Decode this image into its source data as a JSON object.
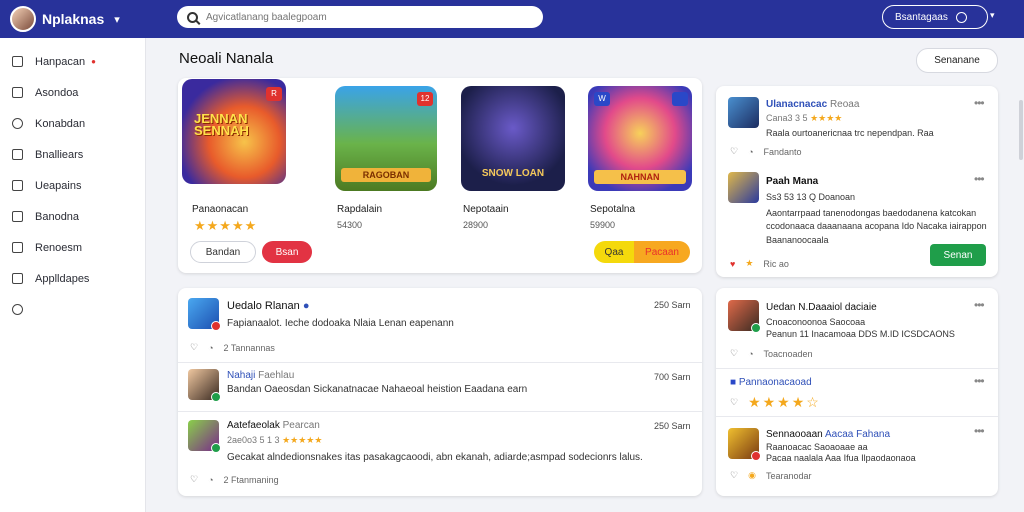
{
  "header": {
    "brand_name": "Nplaknas",
    "search_placeholder": "Agvicatlanang baalegpoam",
    "account_label": "Bsantagaas"
  },
  "sidebar": {
    "items": [
      {
        "label": "Hanpacan",
        "badge": "●"
      },
      {
        "label": "Asondoa"
      },
      {
        "label": "Konabdan"
      },
      {
        "label": "Bnalliears"
      },
      {
        "label": "Ueapains"
      },
      {
        "label": "Banodna"
      },
      {
        "label": "Renoesm"
      },
      {
        "label": "Applldapes"
      },
      {
        "label": ""
      }
    ]
  },
  "main": {
    "title": "Neoali Nanala",
    "action_label": "Senanane",
    "games": [
      {
        "name": "Panaonacan",
        "sub": "",
        "rating": "★★★★★",
        "thumb_text": "JENNAN SENNAH",
        "tag": "R"
      },
      {
        "name": "Rapdalain",
        "sub": "54300",
        "rating": "",
        "thumb_text": "RAGOBAN",
        "tag": "12"
      },
      {
        "name": "Nepotaain",
        "sub": "28900",
        "rating": "",
        "thumb_text": "SNOW LOAN",
        "tag": ""
      },
      {
        "name": "Sepotalna",
        "sub": "59900",
        "rating": "",
        "thumb_text": "NAHNAN",
        "tag": "W"
      }
    ],
    "game_buttons": {
      "primary": "Bandan",
      "secondary": "Bsan",
      "yellow": "Qaa",
      "orange": "Pacaan"
    },
    "feed": [
      {
        "name": "Uedalo Rlanan",
        "time": "250 Sarn",
        "text": "Fapianaalot. Ieche dodoaka Nlaia Lenan eapenann",
        "footer_count": "2",
        "footer_text": "Tannannas"
      },
      {
        "name": "Nahaji",
        "name_suffix": "Faehlau",
        "time": "700 Sarn",
        "text": "Bandan Oaeosdan Sickanatnacae Nahaeoal heistion Eaadana earn",
        "footer_count": "",
        "footer_text": ""
      },
      {
        "name": "Aatefaeolak",
        "name_suffix": "Pearcan",
        "time": "250 Sarn",
        "meta": "2ae0o3 5 1 3",
        "rating": "★★★★★",
        "text": "Gecakat alndedionsnakes itas pasakagcaoodi, abn ekanah, adiarde;asmpad sodecionrs lalus.",
        "footer_count": "2",
        "footer_text": "Ftanmaning"
      }
    ]
  },
  "aside": {
    "top": [
      {
        "name": "Ulanacnacac",
        "name_suffix": "Reoaa",
        "meta": "Cana3 3 5",
        "rating": "★★★★",
        "text": "Raala ourtoanericnaa trc nependpan. Raa",
        "footer": "Fandanto"
      },
      {
        "name": "Paah Mana",
        "meta": "Ss3 53 13 Q Doanoan",
        "text1": "Aaontarrpaad tanenodongas baedodanena katcokan",
        "text2": "ccodonaaca daaanaana acopana Ido Nacaka iairappon",
        "text3": "Baananoocaala",
        "footer": "Ric ao",
        "button": "Senan"
      }
    ],
    "bottom": [
      {
        "name": "Uedan N.Daaaiol daciaie",
        "meta": "Cnoaconoonoa Saocoaa",
        "text": "Peanun 11 Inacamoaa DDS M.ID ICSDCAONS",
        "footer": "Toacnoaden"
      },
      {
        "name": "Pannaonacaoad",
        "rating": "★★★★☆"
      },
      {
        "name": "Sennaooaan",
        "name_suffix": "Aacaa Fahana",
        "meta": "Raanoacac Saoaoaae aa",
        "text": "Pacaa naalala Aaa Ifua Ilpaodaonaoa",
        "footer": "Tearanodar"
      }
    ]
  }
}
